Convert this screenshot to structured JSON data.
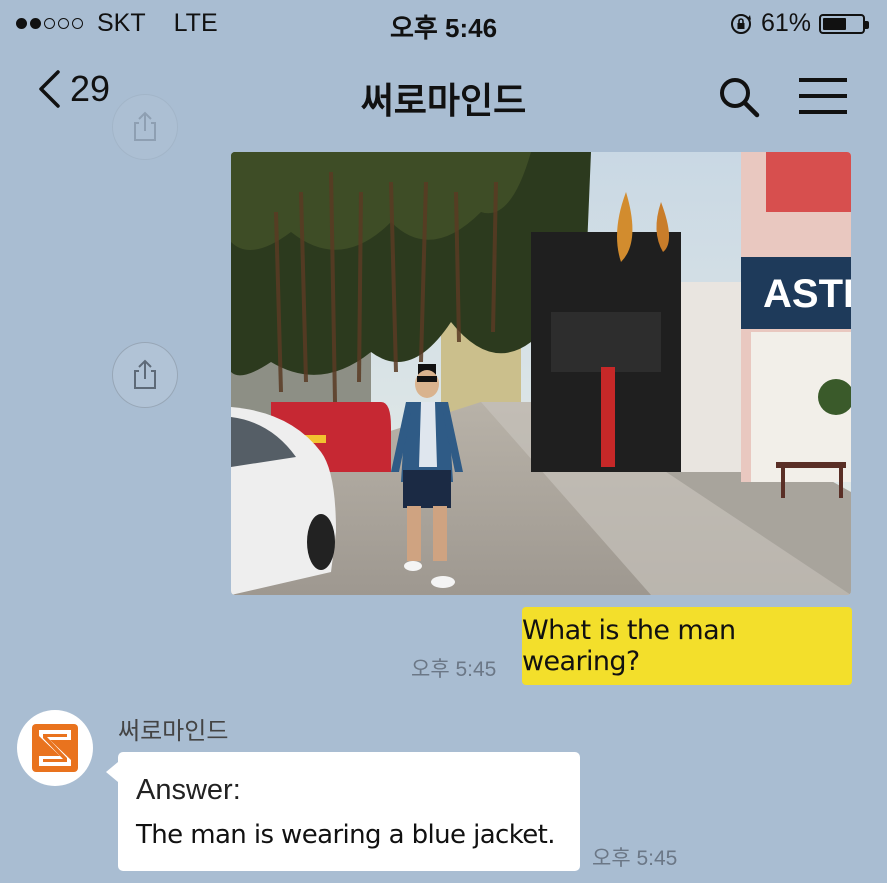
{
  "status_bar": {
    "carrier": "SKT",
    "network": "LTE",
    "time": "오후 5:46",
    "battery": "61%",
    "battery_level": 0.61
  },
  "nav": {
    "back_count": "29",
    "title": "써로마인드",
    "icons": [
      "chevron-left-icon",
      "search-icon",
      "menu-icon"
    ]
  },
  "photo": {
    "storefront_sign": "ASTER"
  },
  "messages": {
    "outgoing": {
      "text": "What is the man wearing?",
      "time": "오후 5:45"
    },
    "incoming": {
      "sender": "써로마인드",
      "label": "Answer:",
      "text": "The man is wearing a blue jacket.",
      "time": "오후 5:45"
    }
  },
  "colors": {
    "background": "#a9bdd2",
    "outgoing_bubble": "#f3df2b",
    "incoming_bubble": "#ffffff",
    "avatar_accent": "#e9731e"
  }
}
